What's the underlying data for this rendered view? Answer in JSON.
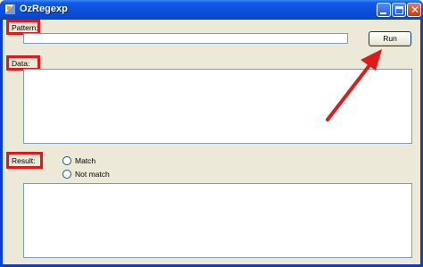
{
  "window": {
    "title": "OzRegexp",
    "controls": [
      "minimize",
      "maximize",
      "close"
    ]
  },
  "pattern": {
    "label": "Pattern:",
    "value": ""
  },
  "run_button": {
    "label": "Run"
  },
  "data": {
    "label": "Data:",
    "value": ""
  },
  "result": {
    "label": "Result:",
    "options": [
      "Match",
      "Not match"
    ],
    "output": ""
  },
  "annotation_colors": {
    "highlight": "#e01a1a",
    "arrow": "#e01a1a"
  }
}
